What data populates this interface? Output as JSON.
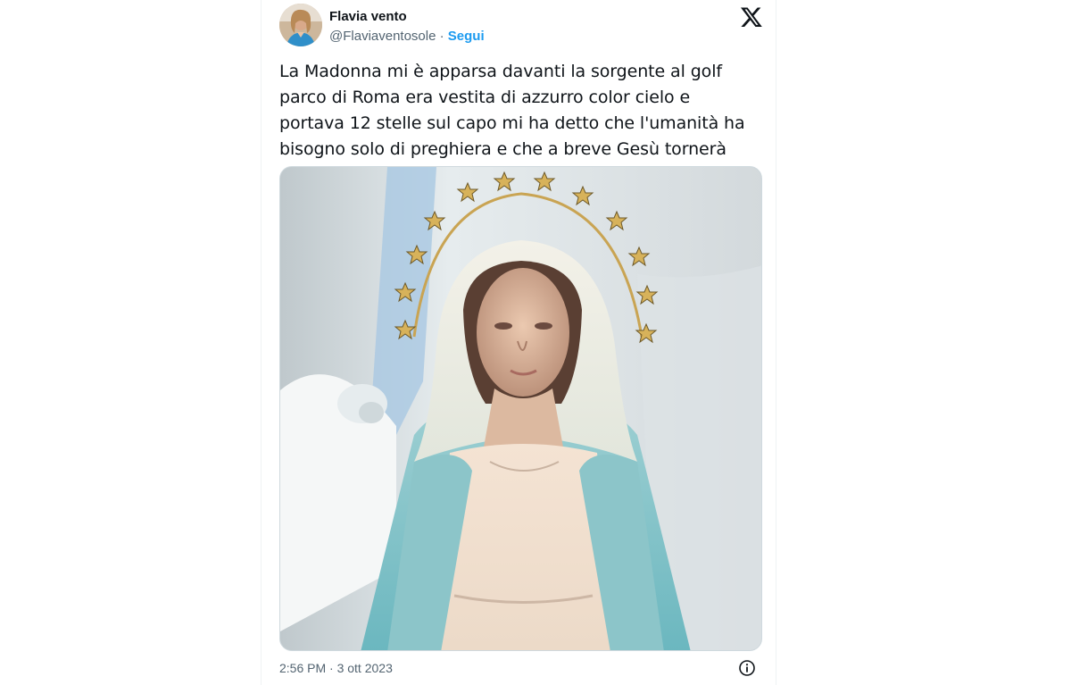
{
  "tweet": {
    "author": {
      "display_name": "Flavia vento",
      "handle": "@Flaviaventosole",
      "separator": " · ",
      "follow_label": "Segui",
      "avatar_icon": "profile-photo"
    },
    "brand_icon": "x-logo",
    "text_lines": [
      "La Madonna mi è apparsa davanti la sorgente al golf",
      "parco di Roma era vestita di azzurro color cielo e",
      "portava 12 stelle sul capo mi ha detto che l'umanità ha",
      "bisogno solo di preghiera e che a breve Gesù tornerà"
    ],
    "media": {
      "kind": "photo",
      "subject_icon": "madonna-statue-photo"
    },
    "timestamp": "2:56 PM · 3 ott 2023",
    "info_icon": "info-icon"
  },
  "colors": {
    "text": "#0f1419",
    "muted": "#536471",
    "accent": "#1d9bf0",
    "border": "#cfd9de"
  }
}
